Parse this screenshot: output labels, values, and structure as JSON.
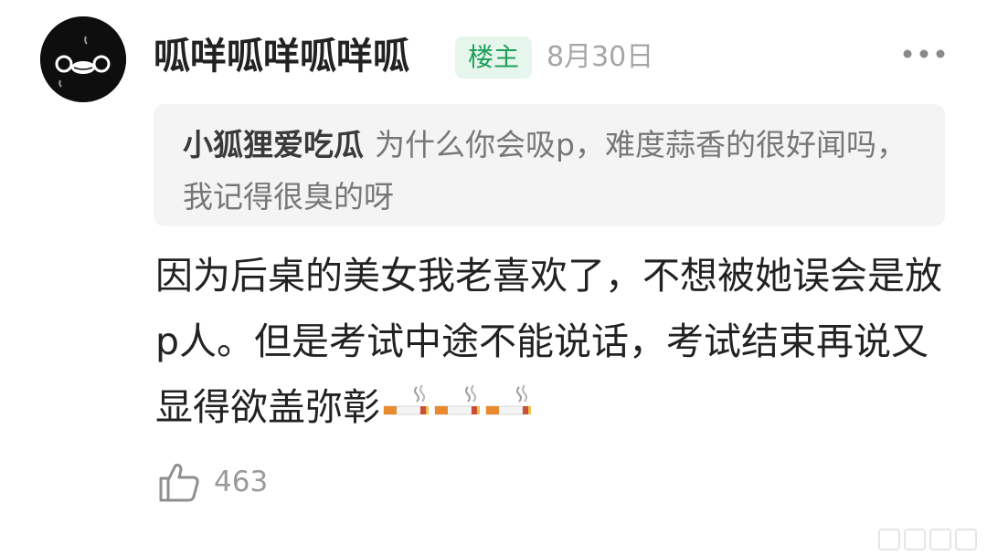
{
  "comment": {
    "username": "呱咩呱咩呱咩呱",
    "op_badge": "楼主",
    "date": "8月30日",
    "more_icon": "more-dots-icon",
    "avatar_icon": "black-face-avatar",
    "reply_to": {
      "author": "小狐狸爱吃瓜",
      "text": "为什么你会吸p，难度蒜香的很好闻吗，我记得很臭的呀"
    },
    "content": "因为后桌的美女我老喜欢了，不想被她误会是放p人。但是考试中途不能说话，考试结束再说又显得欲盖弥彰",
    "emojis": [
      "cigarette-emoji",
      "cigarette-emoji",
      "cigarette-emoji"
    ],
    "like_icon": "thumbs-up-icon",
    "like_count": "463"
  },
  "colors": {
    "badge_bg": "#e6f6ec",
    "badge_text": "#1fa05a",
    "quote_bg": "#f4f4f4",
    "muted_text": "#a6a6a6"
  }
}
